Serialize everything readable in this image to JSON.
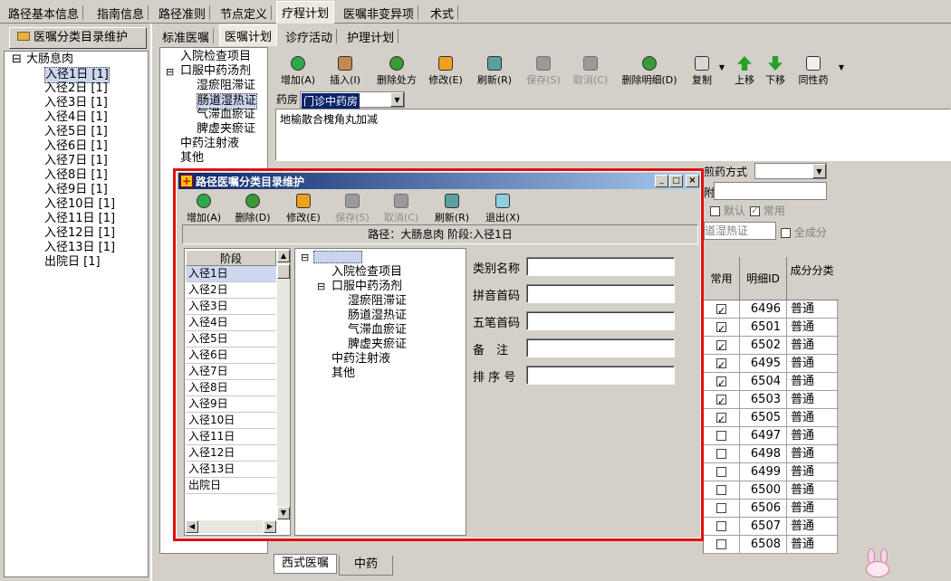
{
  "top_tabs": [
    {
      "label": "路径基本信息"
    },
    {
      "label": "指南信息"
    },
    {
      "label": "路径准则"
    },
    {
      "label": "节点定义"
    },
    {
      "label": "疗程计划"
    },
    {
      "label": "医嘱非变异项"
    },
    {
      "label": "术式"
    }
  ],
  "left_button": {
    "label": "医嘱分类目录维护"
  },
  "path_tree": {
    "root": "大肠息肉",
    "items": [
      "入径1日 [1]",
      "入径2日 [1]",
      "入径3日 [1]",
      "入径4日 [1]",
      "入径5日 [1]",
      "入径6日 [1]",
      "入径7日 [1]",
      "入径8日 [1]",
      "入径9日 [1]",
      "入径10日 [1]",
      "入径11日 [1]",
      "入径12日 [1]",
      "入径13日 [1]",
      "出院日 [1]"
    ]
  },
  "sub_tabs": [
    {
      "label": "标准医嘱"
    },
    {
      "label": "医嘱计划"
    },
    {
      "label": "诊疗活动"
    },
    {
      "label": "护理计划"
    }
  ],
  "category_tree": {
    "items": [
      "入院检查项目",
      "口服中药汤剂",
      "湿瘀阻滞证",
      "肠道湿热证",
      "气滞血瘀证",
      "脾虚夹瘀证",
      "中药注射液",
      "其他"
    ]
  },
  "main_toolbar": [
    {
      "label": "增加(A)"
    },
    {
      "label": "插入(I)"
    },
    {
      "label": "删除处方"
    },
    {
      "label": "修改(E)"
    },
    {
      "label": "刷新(R)"
    },
    {
      "label": "保存(S)"
    },
    {
      "label": "取消(C)"
    },
    {
      "label": "删除明细(D)"
    },
    {
      "label": "复制"
    },
    {
      "label": "上移"
    },
    {
      "label": "下移"
    },
    {
      "label": "同性药"
    }
  ],
  "pharmacy": {
    "label": "药房",
    "value": "门诊中药房"
  },
  "prescription_text": "地榆散合槐角丸加减",
  "right_fields": {
    "decoct_label": "煎药方式",
    "attach_label": "附",
    "default_label": "默认",
    "common_label": "常用",
    "syndrome_value": "道湿热证",
    "full_label": "全成分"
  },
  "detail_grid": {
    "headers": [
      "常用",
      "明细ID",
      "成分分类"
    ],
    "rows": [
      {
        "common": true,
        "id": "6496",
        "cls": "普通"
      },
      {
        "common": true,
        "id": "6501",
        "cls": "普通"
      },
      {
        "common": true,
        "id": "6502",
        "cls": "普通"
      },
      {
        "common": true,
        "id": "6495",
        "cls": "普通"
      },
      {
        "common": true,
        "id": "6504",
        "cls": "普通"
      },
      {
        "common": true,
        "id": "6503",
        "cls": "普通"
      },
      {
        "common": true,
        "id": "6505",
        "cls": "普通"
      },
      {
        "common": false,
        "id": "6497",
        "cls": "普通"
      },
      {
        "common": false,
        "id": "6498",
        "cls": "普通"
      },
      {
        "common": false,
        "id": "6499",
        "cls": "普通"
      },
      {
        "common": false,
        "id": "6500",
        "cls": "普通"
      },
      {
        "common": false,
        "id": "6506",
        "cls": "普通"
      },
      {
        "common": false,
        "id": "6507",
        "cls": "普通"
      },
      {
        "common": false,
        "id": "6508",
        "cls": "普通"
      }
    ]
  },
  "bottom_tabs": [
    {
      "label": "西式医嘱"
    },
    {
      "label": "中药"
    }
  ],
  "dialog": {
    "title": "路径医嘱分类目录维护",
    "toolbar": [
      {
        "label": "增加(A)"
      },
      {
        "label": "删除(D)"
      },
      {
        "label": "修改(E)"
      },
      {
        "label": "保存(S)"
      },
      {
        "label": "取消(C)"
      },
      {
        "label": "刷新(R)"
      },
      {
        "label": "退出(X)"
      }
    ],
    "path_info": "路径：大肠息肉   阶段:入径1日",
    "stage_header": "阶段",
    "stages": [
      "入径1日",
      "入径2日",
      "入径3日",
      "入径4日",
      "入径5日",
      "入径6日",
      "入径7日",
      "入径8日",
      "入径9日",
      "入径10日",
      "入径11日",
      "入径12日",
      "入径13日",
      "出院日"
    ],
    "tree_items": [
      "入院检查项目",
      "口服中药汤剂",
      "湿瘀阻滞证",
      "肠道湿热证",
      "气滞血瘀证",
      "脾虚夹瘀证",
      "中药注射液",
      "其他"
    ],
    "form": {
      "name_label": "类别名称",
      "pinyin_label": "拼音首码",
      "wubi_label": "五笔首码",
      "note_label": "备　注",
      "order_label": "排 序 号"
    }
  },
  "colors": {
    "accent": "#ff0000",
    "selection": "#0a246a",
    "titlebar": "#0a246a"
  }
}
